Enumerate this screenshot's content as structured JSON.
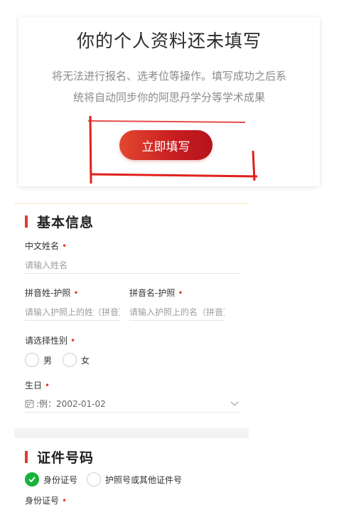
{
  "prompt": {
    "title": "你的个人资料还未填写",
    "desc_line1": "将无法进行报名、选考位等操作。填写成功之后系",
    "desc_line2": "统将自动同步你的阿思丹学分等学术成果",
    "button_label": "立即填写"
  },
  "basic": {
    "section_title": "基本信息",
    "chinese_name": {
      "label": "中文姓名",
      "required": "•",
      "placeholder": "请输入姓名"
    },
    "pinyin_surname": {
      "label": "拼音姓-护照",
      "required": "•",
      "placeholder": "请输入护照上的姓（拼音）"
    },
    "pinyin_given": {
      "label": "拼音名-护照",
      "required": "•",
      "placeholder": "请输入护照上的名（拼音）"
    },
    "gender": {
      "label": "请选择性别",
      "required": "•",
      "options": [
        "男",
        "女"
      ]
    },
    "birthday": {
      "label": "生日",
      "required": "•",
      "placeholder": ":例：2002-01-02"
    }
  },
  "id_section": {
    "section_title": "证件号码",
    "options": [
      "身份证号",
      "护照号或其他证件号"
    ],
    "selected": "身份证号",
    "id_number": {
      "label": "身份证号",
      "required": "•"
    }
  },
  "colors": {
    "accent": "#e23b2b",
    "check": "#18b33b",
    "button": "#c71d22"
  }
}
